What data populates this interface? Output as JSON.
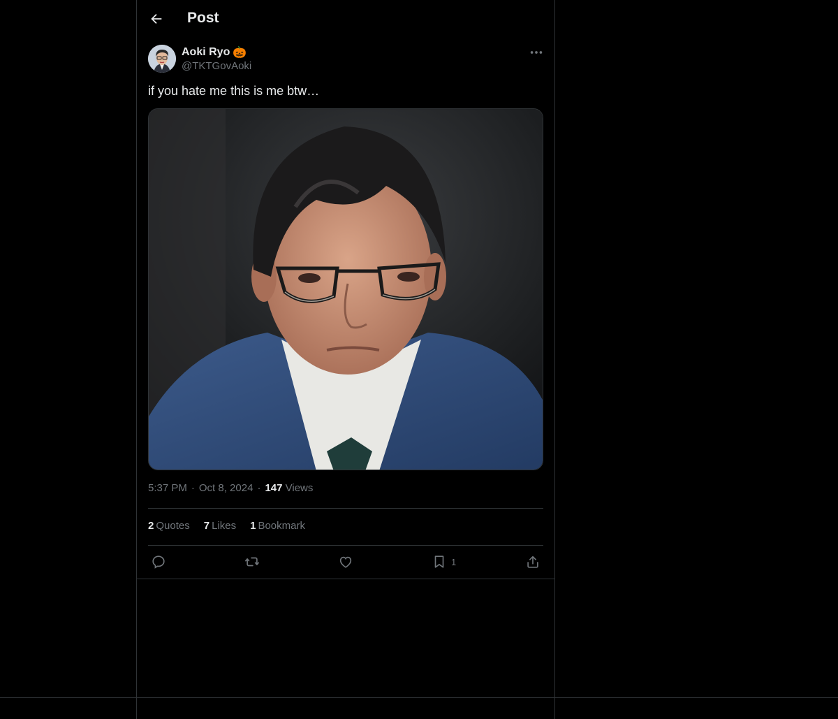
{
  "header": {
    "title": "Post"
  },
  "author": {
    "display_name": "Aoki Ryo",
    "badge_emoji": "🎃",
    "handle": "@TKTGovAoki"
  },
  "post": {
    "text": "if you hate me this is me btw…",
    "time": "5:37 PM",
    "date": "Oct 8, 2024",
    "separator": "·",
    "views_count": "147",
    "views_label": "Views"
  },
  "stats": {
    "quotes_count": "2",
    "quotes_label": "Quotes",
    "likes_count": "7",
    "likes_label": "Likes",
    "bookmarks_count": "1",
    "bookmarks_label": "Bookmark"
  },
  "actions": {
    "bookmark_count": "1",
    "icons": [
      "reply-icon",
      "repost-icon",
      "like-icon",
      "bookmark-icon",
      "share-icon"
    ]
  },
  "colors": {
    "background": "#000000",
    "text": "#e7e9ea",
    "secondary_text": "#71767b",
    "border": "#2f3336"
  }
}
